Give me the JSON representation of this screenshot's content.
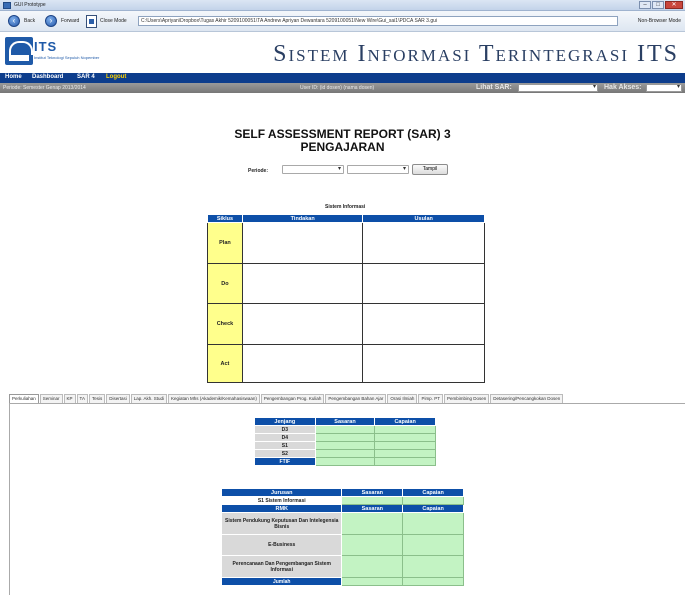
{
  "window": {
    "title": "GUI Prototype",
    "controls": [
      "–",
      "□",
      "✕"
    ]
  },
  "toolbar": {
    "back_label": "Back",
    "forward_label": "Forward",
    "close_mode_label": "Close Mode",
    "address": "C:\\Users\\Apriyan\\Dropbox\\Tugas Akhir 5209100051\\TA Andrew Apriyan Dewantara 5209100051\\New Wire\\Gui_sai1\\PDCA SAR 3.gui",
    "non_browser_mode": "Non-Browser Mode"
  },
  "banner": {
    "logo_text": "ITS",
    "logo_sub": "Institut Teknologi Sepuluh Nopember",
    "site_title": "Sistem Informasi Terintegrasi ITS"
  },
  "nav": {
    "home": "Home",
    "dashboard": "Dashboard",
    "sar4": "SAR 4",
    "logout": "Logout"
  },
  "status": {
    "semester": "Periode: Semester Genap 2013/2014",
    "user_id": "User ID: (id dosen) (nama dosen)",
    "lihat_sar": "Lihat SAR:",
    "hak_akses": "Hak Akses:"
  },
  "main": {
    "title_line1": "SELF ASSESSMENT REPORT (SAR) 3",
    "title_line2": "PENGAJARAN",
    "periode_label": "Periode:",
    "tampil_label": "Tampil",
    "section_title": "Sistem Informasi",
    "pdca": {
      "headers": [
        "Siklus",
        "Tindakan",
        "Usulan"
      ],
      "rows": [
        "Plan",
        "Do",
        "Check",
        "Act"
      ]
    }
  },
  "tabs": [
    "Perkuliahan",
    "Seminar",
    "KP",
    "TA",
    "Tesis",
    "Disertasi",
    "Lap. Akh. Studi",
    "Kegiatan Mhs (Akademik/Kemahasiswaan)",
    "Pengembangan Prog. Kuliah",
    "Pengembangan Bahan Ajar",
    "Orasi Ilmiah",
    "Pimp. PT",
    "Pembimbing Dosen",
    "Detasering/Pencangkokan Dosen"
  ],
  "jenjang_table": {
    "headers": [
      "Jenjang",
      "Sasaran",
      "Capaian"
    ],
    "rows": [
      "D3",
      "D4",
      "S1",
      "S2",
      "FTIF"
    ]
  },
  "jurusan_table": {
    "headers": [
      "Jurusan",
      "Sasaran",
      "Capaian"
    ],
    "first_row": "S1 Sistem Informasi",
    "rmk_headers": [
      "RMK",
      "Sasaran",
      "Capaian"
    ],
    "rmk_rows": [
      "Sistem Pendukung Keputusan Dan Intelegensia Bisnis",
      "E-Business",
      "Perencanaan Dan Pengembangan Sistem Informasi"
    ],
    "total_label": "Jumlah"
  }
}
